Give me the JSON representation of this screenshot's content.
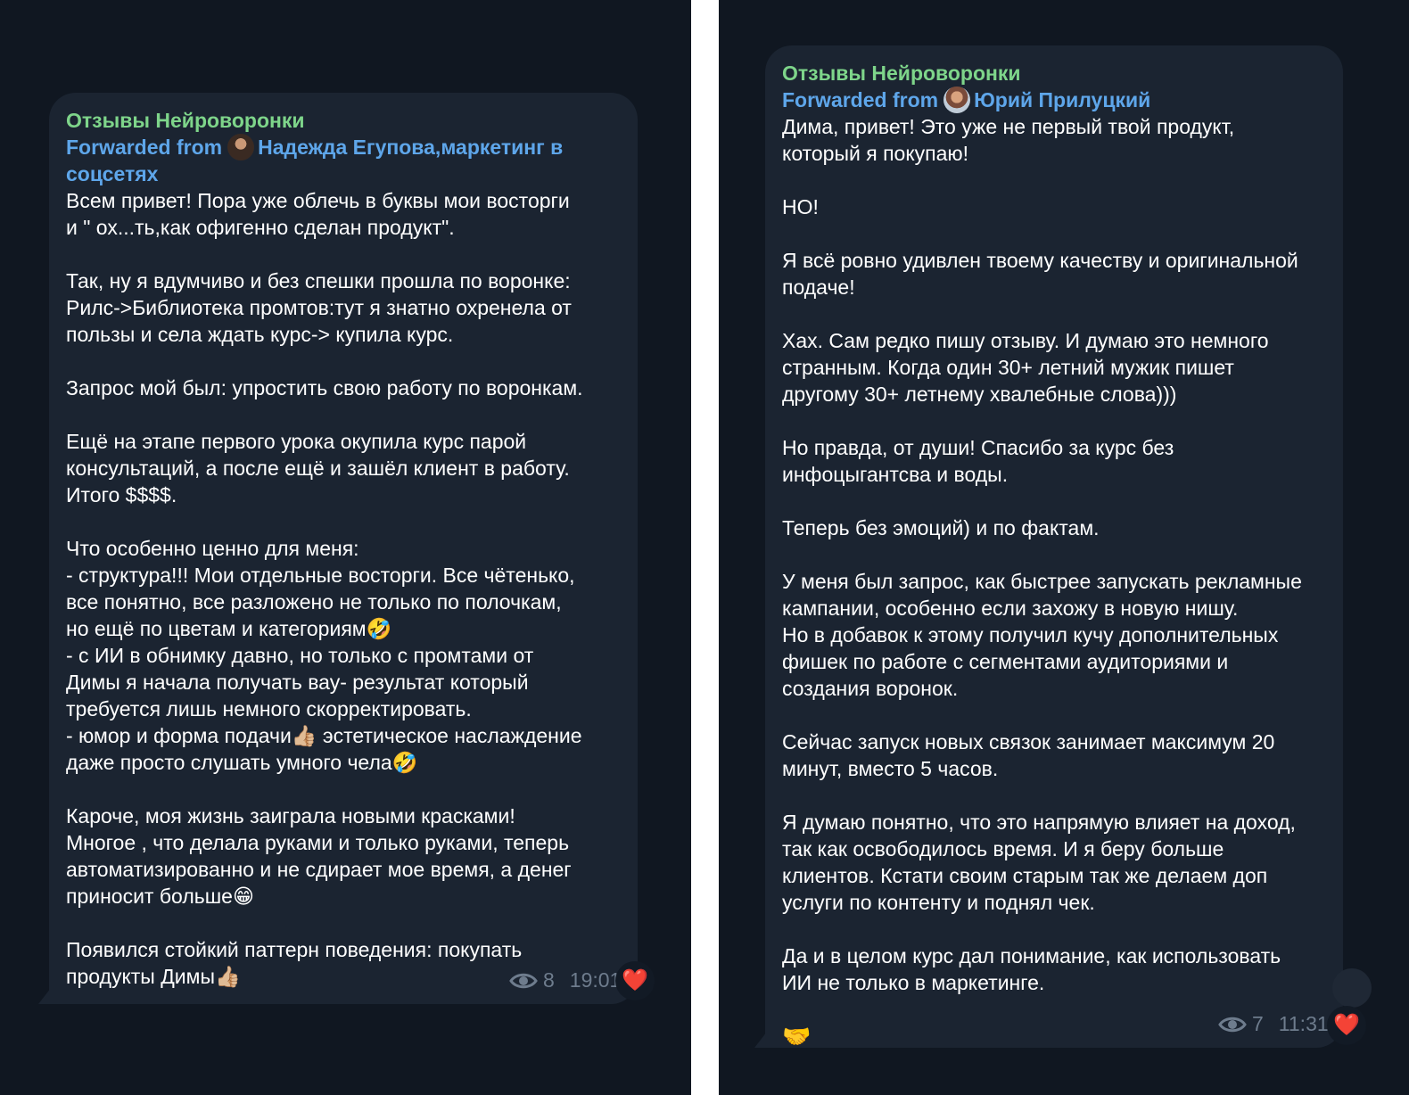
{
  "left": {
    "channel": "Отзывы Нейроворонки",
    "forwarded_prefix": "Forwarded from",
    "author": "Надежда Егупова,маркетинг в соцсетях",
    "paragraphs": [
      "Всем привет! Пора уже облечь в буквы мои восторги\nи \" ох...ть,как офигенно сделан продукт\".",
      "Так, ну я вдумчиво и без спешки прошла по воронке:\nРилс->Библиотека промтов:тут я знатно охренела от\nпользы и села ждать курс-> купила курс.",
      "Запрос мой был: упростить свою работу по воронкам.",
      "Ещё на этапе первого урока окупила курс парой\nконсультаций, а после ещё и зашёл клиент в работу.\nИтого $$$$.",
      "Что особенно ценно для меня:\n- структура!!! Мои отдельные восторги. Все чётенько,\nвсе понятно, все разложено не только по полочкам,\nно ещё по цветам и категориям🤣\n- с ИИ в обнимку давно, но только с промтами от\nДимы я начала получать вау- результат который\nтребуется лишь немного скорректировать.\n- юмор и форма подачи👍🏼 эстетическое наслаждение\nдаже просто слушать умного чела🤣",
      "Кароче, моя жизнь заиграла новыми красками!\nМногое , что делала руками и только руками, теперь\nавтоматизированно и не сдирает мое время, а денег\nприносит больше😁",
      "Появился стойкий паттерн поведения: покупать\nпродукты Димы👍🏼"
    ],
    "views": "8",
    "time": "19:01",
    "reaction": "❤️"
  },
  "right": {
    "channel": "Отзывы Нейроворонки",
    "forwarded_prefix": "Forwarded from",
    "author": "Юрий Прилуцкий",
    "paragraphs": [
      "Дима, привет! Это уже не первый твой продукт,\nкоторый я покупаю!",
      "НО!",
      "Я всё ровно удивлен твоему качеству и оригинальной\nподаче!",
      "Хах. Сам редко пишу отзыву. И думаю это немного\nстранным. Когда один 30+ летний мужик пишет\nдругому 30+ летнему хвалебные слова)))",
      "Но правда, от души! Спасибо за курс без\nинфоцыгантсва и воды.",
      "Теперь без эмоций) и по фактам.",
      "У меня был запрос, как быстрее запускать рекламные\nкампании, особенно если захожу в новую нишу.\nНо в добавок к этому получил кучу дополнительных\nфишек по работе с сегментами аудиториями и\nсоздания воронок.",
      "Сейчас запуск новых связок занимает максимум 20\nминут, вместо 5 часов.",
      "Я думаю понятно, что это напрямую влияет на доход,\nтак как освободилось время. И я беру больше\nклиентов. Кстати своим старым так же делаем доп\nуслуги по контенту и поднял чек.",
      "Да и в целом курс дал понимание, как использовать\nИИ не только в маркетинге."
    ],
    "footer_emoji": "🤝",
    "views": "7",
    "time": "11:31",
    "reaction": "❤️"
  },
  "icons": {
    "views": "eye-icon",
    "reaction": "heart-icon",
    "avatar_left": "avatar",
    "avatar_right": "avatar"
  },
  "colors": {
    "background": "#101721",
    "bubble": "#1b2431",
    "channel_name": "#7ed58a",
    "forwarded": "#5ea6ea",
    "meta": "#6e7c8d",
    "heart": "#e23b3b"
  }
}
